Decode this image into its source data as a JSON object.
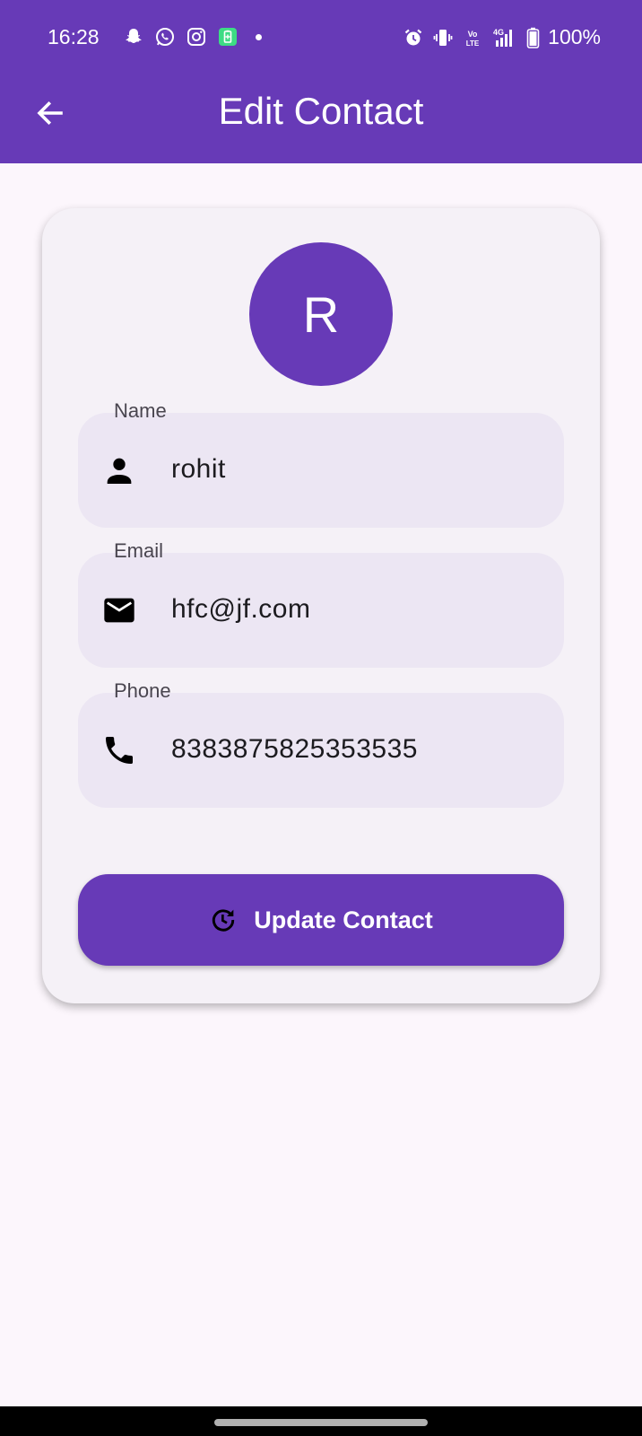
{
  "status_bar": {
    "time": "16:28",
    "battery_text": "100%",
    "left_icons": [
      "snapchat-icon",
      "whatsapp-icon",
      "instagram-icon",
      "battery-saver-icon",
      "notification-dot"
    ],
    "right_icons": [
      "alarm-icon",
      "vibrate-icon",
      "volte-icon",
      "signal-4g-icon",
      "battery-icon"
    ]
  },
  "app_bar": {
    "title": "Edit Contact",
    "back_icon": "arrow-back-icon"
  },
  "avatar": {
    "initial": "R"
  },
  "fields": {
    "name": {
      "label": "Name",
      "value": "rohit",
      "icon": "person-icon"
    },
    "email": {
      "label": "Email",
      "value": "hfc@jf.com",
      "icon": "mail-icon"
    },
    "phone": {
      "label": "Phone",
      "value": "8383875825353535",
      "icon": "phone-icon"
    }
  },
  "update_button": {
    "label": "Update Contact",
    "icon": "update-icon"
  },
  "colors": {
    "primary": "#673ab7",
    "background": "#fcf6fc",
    "card": "#f5f1f7",
    "field_fill": "#ece6f3"
  }
}
